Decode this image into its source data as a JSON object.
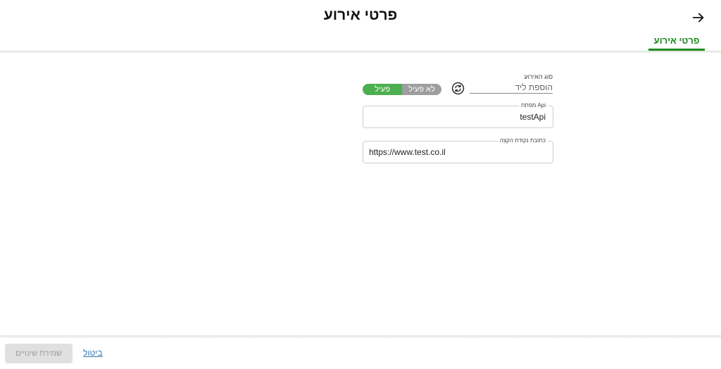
{
  "header": {
    "title": "פרטי אירוע",
    "back_icon": "arrow-right-icon",
    "tabs": [
      {
        "label": "פרטי אירוע",
        "active": true
      }
    ]
  },
  "form": {
    "event_type": {
      "label": "סוג האירוע",
      "value": "הוספת ליד"
    },
    "sync_icon": "sync-icon",
    "status_toggle": {
      "inactive_label": "לא פעיל",
      "active_label": "פעיל",
      "selected": "פעיל"
    },
    "api_key": {
      "label": "מפתח Api",
      "value": "testApi"
    },
    "endpoint_url": {
      "label": "כתובת נקודת הקצה",
      "value": "https://www.test.co.il"
    }
  },
  "footer": {
    "save_label": "שמירת שינויים",
    "cancel_label": "ביטול"
  },
  "colors": {
    "accent_green": "#1f8a1f",
    "toggle_active": "#4caf50",
    "toggle_inactive": "#9e9e9e",
    "link_blue": "#2f78b7",
    "disabled_button": "#e0e0e0"
  }
}
